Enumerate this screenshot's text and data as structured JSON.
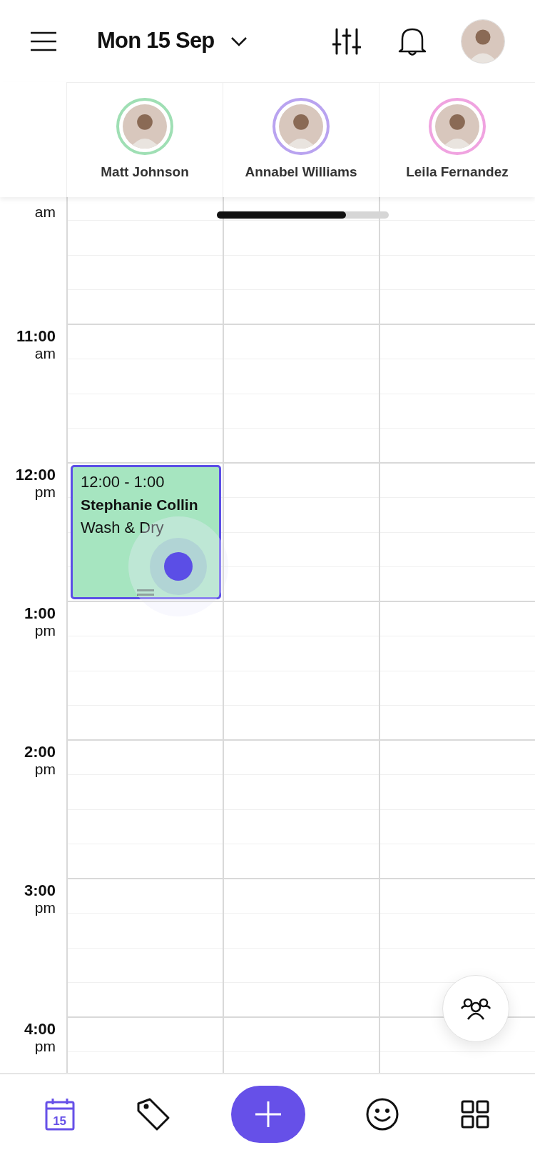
{
  "header": {
    "date": "Mon 15 Sep"
  },
  "staff": [
    {
      "name": "Matt Johnson",
      "color": "#9fdfb4",
      "events": [
        {
          "time": "12:00 - 1:00",
          "client": "Stephanie Collin",
          "service": "Wash & Dry",
          "color": "#a6e5c0"
        }
      ]
    },
    {
      "name": "Annabel Williams",
      "color": "#b9a3f0"
    },
    {
      "name": "Leila Fernandez",
      "color": "#f0a3e0"
    }
  ],
  "hours": [
    {
      "period": "am"
    },
    {
      "hour": "11:00",
      "period": "am"
    },
    {
      "hour": "12:00",
      "period": "pm"
    },
    {
      "hour": "1:00",
      "period": "pm"
    },
    {
      "hour": "2:00",
      "period": "pm"
    },
    {
      "hour": "3:00",
      "period": "pm"
    },
    {
      "hour": "4:00",
      "period": "pm"
    }
  ],
  "nav": [
    {
      "kind": "calendar",
      "label": "15",
      "selected": true
    },
    {
      "kind": "tag",
      "selected": false
    },
    {
      "kind": "add",
      "selected": false
    },
    {
      "kind": "smiley",
      "selected": false
    },
    {
      "kind": "grid",
      "selected": false
    }
  ]
}
